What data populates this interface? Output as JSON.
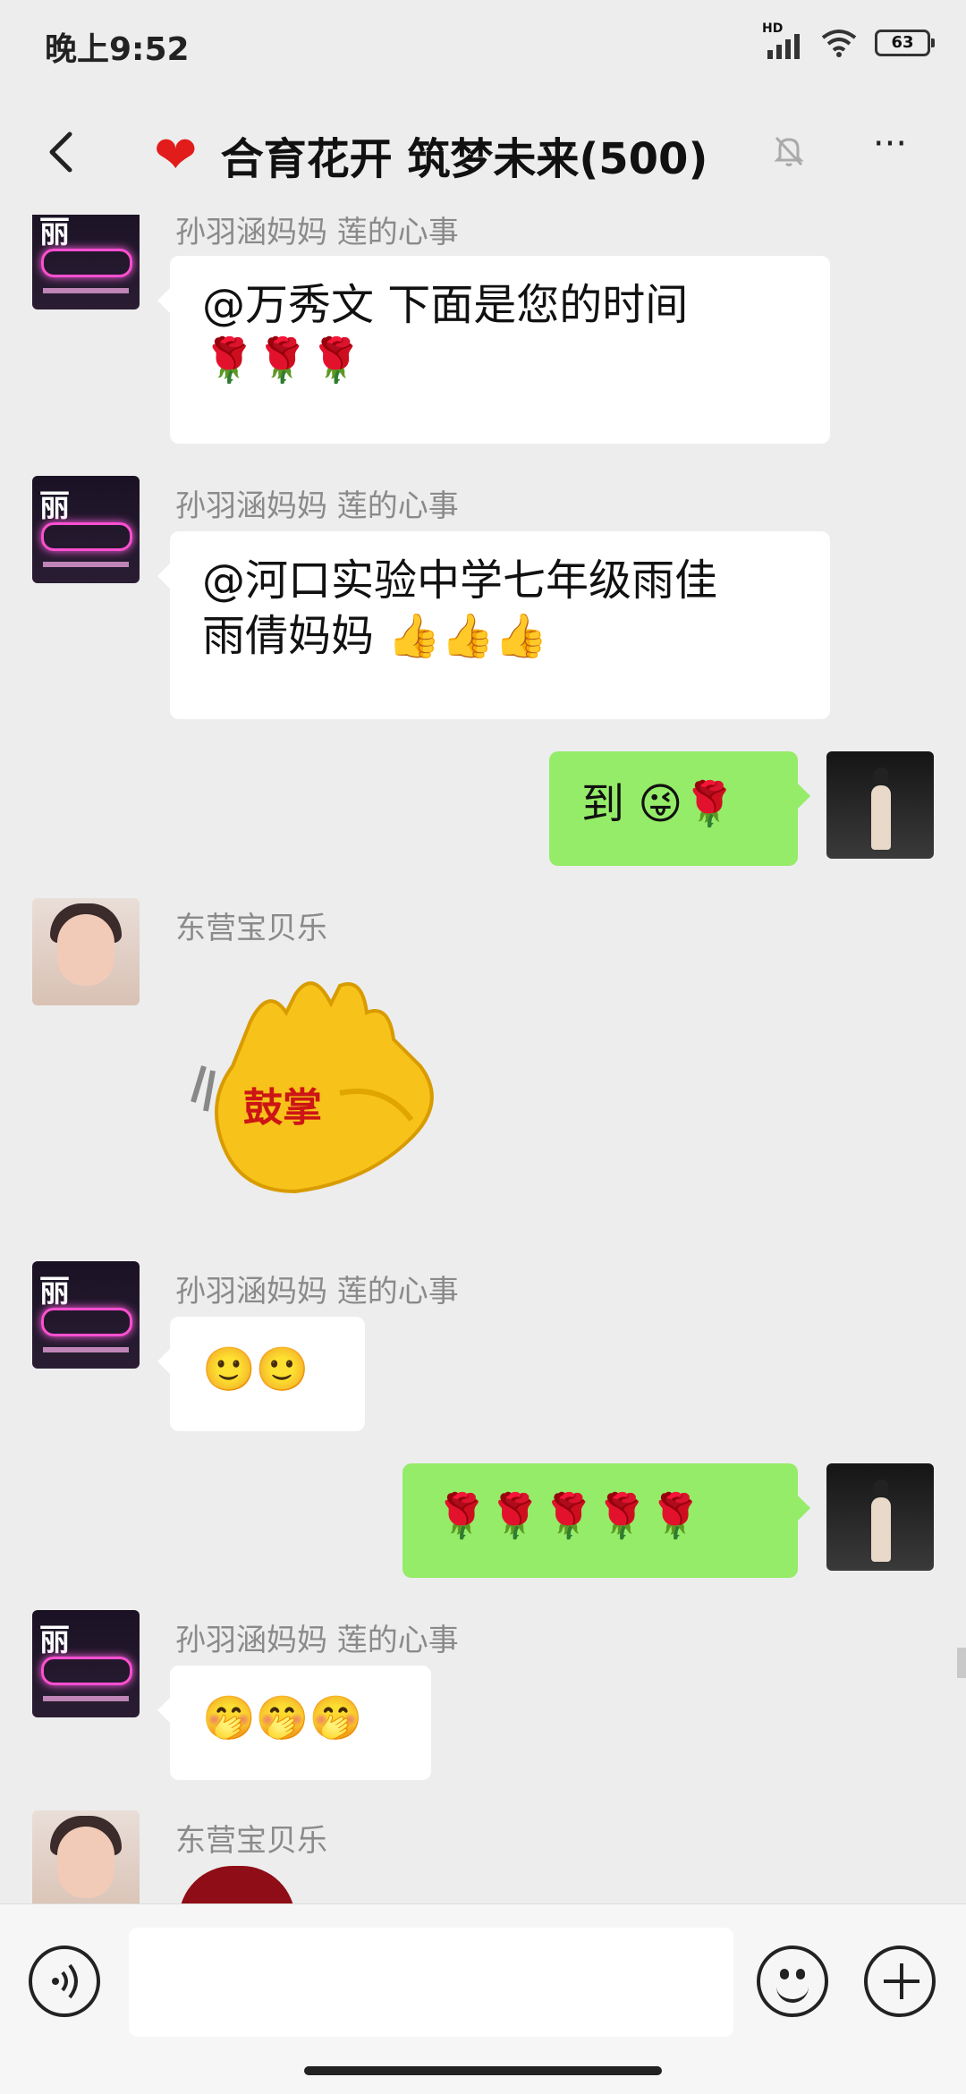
{
  "status_bar": {
    "time": "晚上9:52",
    "network_label": "HD",
    "battery_level": "63"
  },
  "header": {
    "emoji": "❤",
    "title": "合育花开 筑梦未来(500)",
    "more_label": "···"
  },
  "messages": [
    {
      "sender": "孙羽涵妈妈  莲的心事",
      "line1": "@万秀文  下面是您的时间",
      "line2": "🌹🌹🌹"
    },
    {
      "sender": "孙羽涵妈妈  莲的心事",
      "line1": "@河口实验中学七年级雨佳",
      "line2": "雨倩妈妈",
      "line2_emoji": "👍👍👍"
    },
    {
      "text": "到",
      "emoji": "😜🌹"
    },
    {
      "sender": "东营宝贝乐",
      "sticker_label": "鼓掌"
    },
    {
      "sender": "孙羽涵妈妈  莲的心事",
      "text": "🙂🙂"
    },
    {
      "text": "🌹🌹🌹🌹🌹"
    },
    {
      "sender": "孙羽涵妈妈  莲的心事",
      "text": "🤭🤭🤭"
    },
    {
      "sender": "东营宝贝乐"
    }
  ],
  "avatars": {
    "group_member_text": "丽"
  },
  "colors": {
    "self_bubble": "#95ec69",
    "background": "#ededed"
  }
}
